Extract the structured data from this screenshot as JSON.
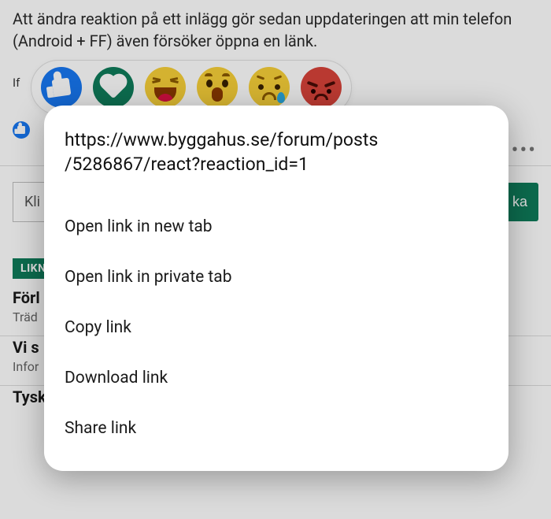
{
  "post": {
    "text": "Att ändra reaktion på ett inlägg gör sedan uppdateringen att min telefon (Android + FF) även försöker öppna en länk.",
    "if_label": "If"
  },
  "reactions": {
    "like": "like",
    "love": "love",
    "haha": "haha",
    "wow": "wow",
    "sad": "sad",
    "angry": "angry"
  },
  "more_label": "•••",
  "quick_reply": {
    "placeholder_visible": "Kli",
    "button_visible": "ka"
  },
  "similar_badge": "LIKN",
  "threads": [
    {
      "title": "Förl",
      "category": "Träd"
    },
    {
      "title": "Vi s",
      "category": "Infor"
    },
    {
      "title": "Tyskland stänger ner för pga dom höga energipriserna",
      "category": ""
    }
  ],
  "context_menu": {
    "url": "https://www.byggahus.se/forum/posts/5286867/react?reaction_id=1",
    "items": [
      "Open link in new tab",
      "Open link in private tab",
      "Copy link",
      "Download link",
      "Share link"
    ]
  }
}
